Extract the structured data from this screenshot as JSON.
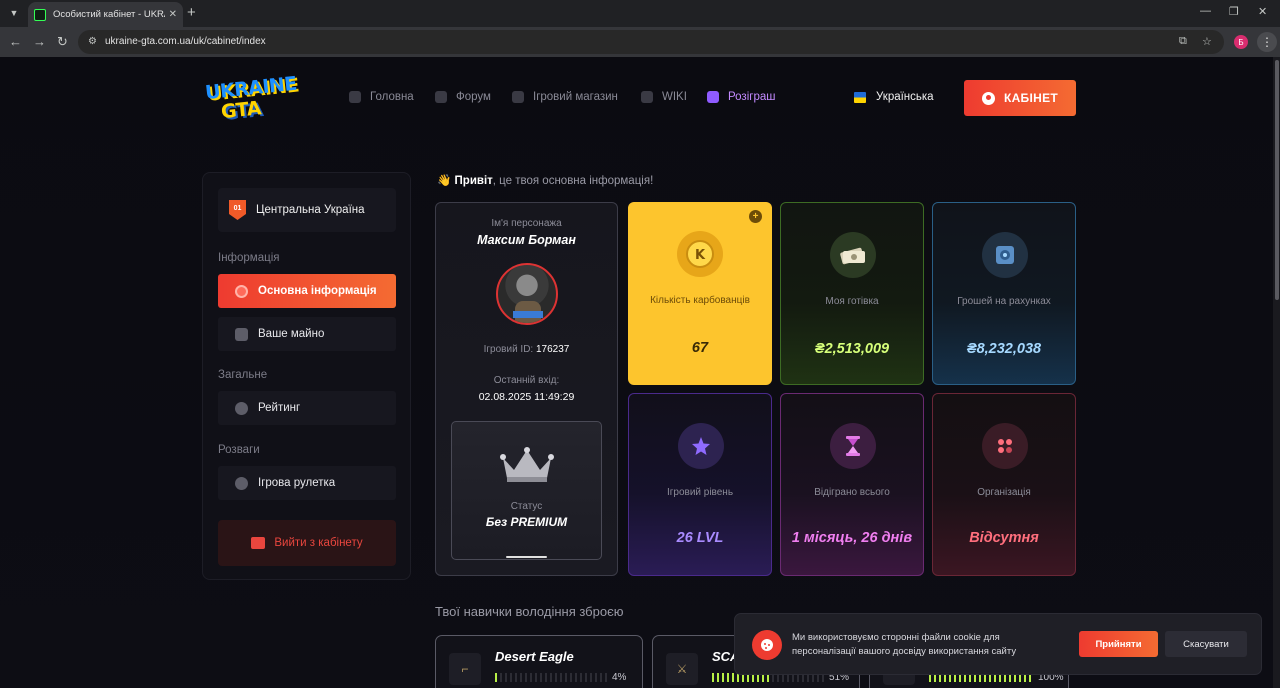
{
  "browser": {
    "tab_title": "Особистий кабінет - UKRAINE",
    "tab_close": "✕",
    "new_tab": "+",
    "url": "ukraine-gta.com.ua/uk/cabinet/index",
    "profile_initial": "Б",
    "controls": {
      "minimize": "—",
      "maximize": "❐",
      "close": "✕"
    }
  },
  "header": {
    "logo_line1": "UKRAINE",
    "logo_line2": "GTA",
    "nav": [
      {
        "label": "Головна",
        "icon": "home-icon"
      },
      {
        "label": "Форум",
        "icon": "hash-icon"
      },
      {
        "label": "Ігровий магазин",
        "icon": "shop-icon"
      },
      {
        "label": "WIKI",
        "icon": "globe-icon"
      },
      {
        "label": "Розіграш",
        "icon": "trophy-icon"
      }
    ],
    "language": "Українська",
    "cabinet_button": "КАБІНЕТ"
  },
  "sidebar": {
    "region_badge": "01",
    "region": "Центральна Україна",
    "section_info": "Інформація",
    "item_basic": "Основна інформація",
    "item_property": "Ваше майно",
    "section_general": "Загальне",
    "item_rating": "Рейтинг",
    "section_games": "Розваги",
    "item_roulette": "Ігрова рулетка",
    "logout": "Вийти з кабінету"
  },
  "main": {
    "greeting_bold": "Привіт",
    "greeting_rest": ", це твоя основна інформація!",
    "profile": {
      "name_label": "Ім'я персонажа",
      "name": "Максим Борман",
      "id_label": "Ігровий ID:",
      "id": "176237",
      "last_login_label": "Останній вхід:",
      "last_login": "02.08.2025 11:49:29",
      "status_label": "Статус",
      "status": "Без PREMIUM"
    },
    "stats": {
      "karb_label": "Кількість карбованців",
      "karb_value": "67",
      "cash_label": "Моя готівка",
      "cash_value": "₴2,513,009",
      "bank_label": "Грошей на рахунках",
      "bank_value": "₴8,232,038",
      "level_label": "Ігровий рівень",
      "level_value": "26 LVL",
      "played_label": "Відіграно всього",
      "played_value": "1 місяць, 26 днів",
      "org_label": "Організація",
      "org_value": "Відсутня"
    },
    "skills_title": "Твої навички володіння зброєю",
    "weapons": [
      {
        "name": "Desert Eagle",
        "percent": "4%",
        "level": 0.04
      },
      {
        "name": "SCAR",
        "percent": "51%",
        "level": 0.51
      },
      {
        "name": "",
        "percent": "100%",
        "level": 1.0
      }
    ]
  },
  "cookie": {
    "text": "Ми використовуємо сторонні файли cookie для персоналізації вашого досвіду використання сайту",
    "accept": "Прийняти",
    "cancel": "Скасувати"
  },
  "colors": {
    "accent": "#ee3b30",
    "karb_card": "#fdc52d",
    "cash_value": "#d6ff7a",
    "bank_value": "#a6d9ff",
    "level_value": "#a98bff",
    "played_value": "#f07ef0",
    "org_value": "#ff6f7d"
  }
}
